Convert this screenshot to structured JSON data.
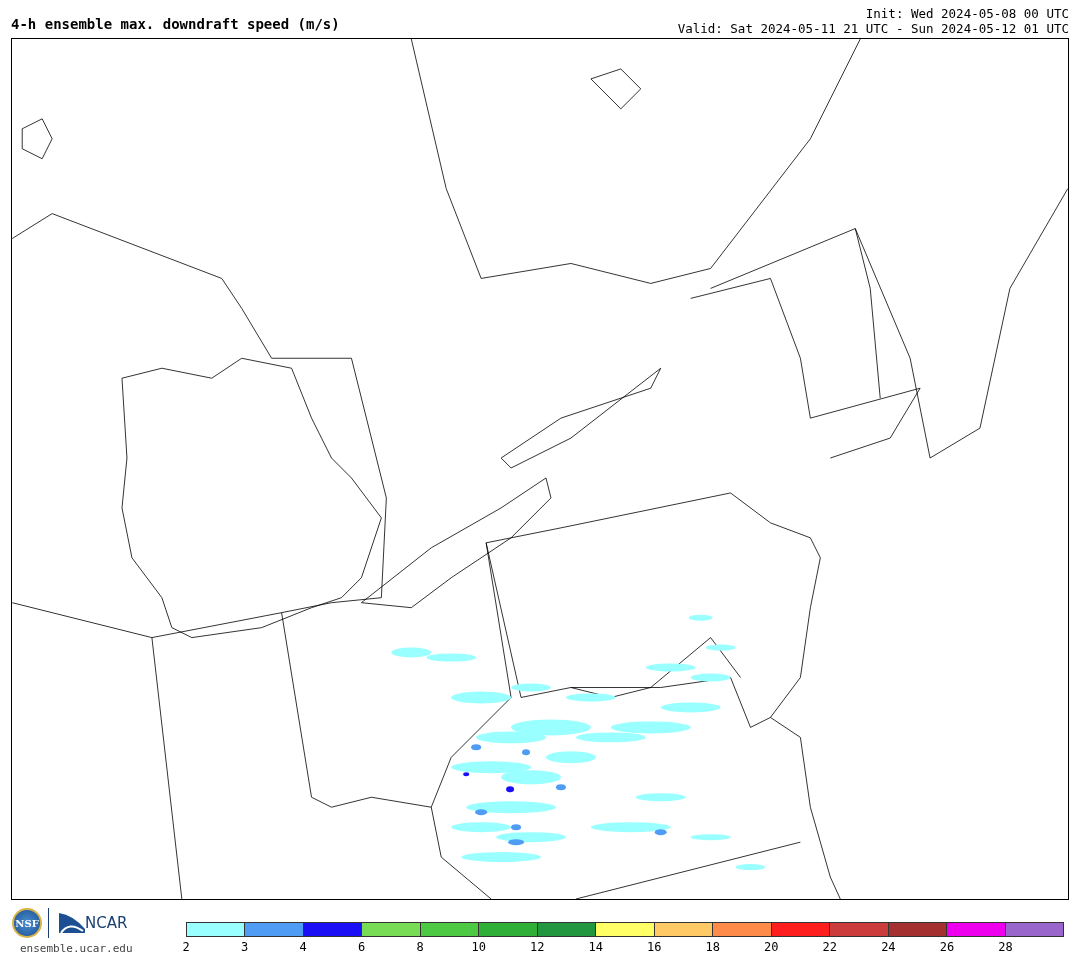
{
  "header": {
    "title": "4-h ensemble max. downdraft speed (m/s)",
    "init": "Init: Wed 2024-05-08 00 UTC",
    "valid": "Valid: Sat 2024-05-11 21 UTC - Sun 2024-05-12 01 UTC"
  },
  "footer": {
    "nsf_logo": "NSF",
    "ncar_logo": "NCAR",
    "site": "ensemble.ucar.edu"
  },
  "colorbar": [
    {
      "color": "#99ffff",
      "label": "2"
    },
    {
      "color": "#4f9cf5",
      "label": "3"
    },
    {
      "color": "#1a0ff5",
      "label": "4"
    },
    {
      "color": "#78dd55",
      "label": "6"
    },
    {
      "color": "#4dc944",
      "label": "8"
    },
    {
      "color": "#30af38",
      "label": "10"
    },
    {
      "color": "#239640",
      "label": "12"
    },
    {
      "color": "#ffff66",
      "label": "14"
    },
    {
      "color": "#ffc966",
      "label": "16"
    },
    {
      "color": "#ff8b4a",
      "label": "18"
    },
    {
      "color": "#ff1e1e",
      "label": "20"
    },
    {
      "color": "#cc3c3c",
      "label": "22"
    },
    {
      "color": "#a53030",
      "label": "24"
    },
    {
      "color": "#ee00ee",
      "label": "26"
    },
    {
      "color": "#9966cc",
      "label": "28"
    }
  ]
}
